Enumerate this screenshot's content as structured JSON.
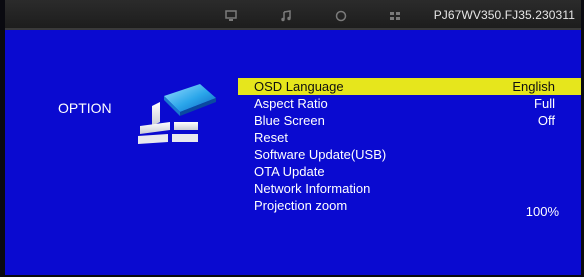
{
  "topbar": {
    "icons": [
      "monitor-icon",
      "music-note-icon",
      "clock-icon",
      "grid-icon"
    ],
    "model": "PJ67WV350.FJ35.230311"
  },
  "section": {
    "title": "OPTION",
    "icon": "option-cube-icon"
  },
  "menu": {
    "items": [
      {
        "label": "OSD Language",
        "value": "English",
        "selected": true
      },
      {
        "label": "Aspect Ratio",
        "value": "Full"
      },
      {
        "label": "Blue Screen",
        "value": "Off"
      },
      {
        "label": "Reset",
        "value": ""
      },
      {
        "label": "Software Update(USB)",
        "value": ""
      },
      {
        "label": "OTA Update",
        "value": ""
      },
      {
        "label": "Network Information",
        "value": ""
      },
      {
        "label": "Projection zoom",
        "value": "100%"
      }
    ]
  },
  "colors": {
    "background": "#0a0ad0",
    "highlight": "#e6e61c",
    "text": "#ffffff",
    "topbar": "#2b2b2b"
  }
}
